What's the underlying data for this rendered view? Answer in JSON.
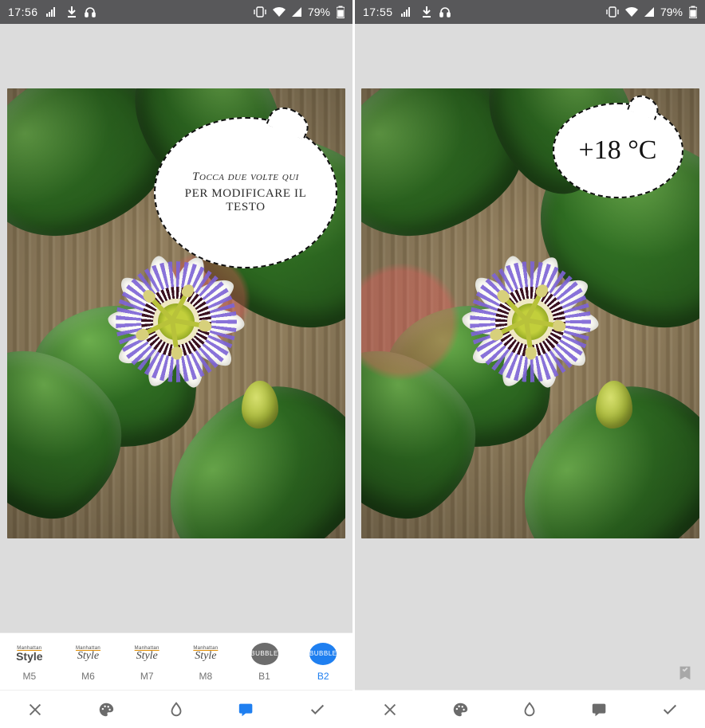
{
  "left": {
    "statusbar": {
      "time": "17:56",
      "battery": "79%"
    },
    "bubble": {
      "line1": "Tocca due volte qui",
      "line2": "PER MODIFICARE IL TESTO"
    },
    "styles": [
      {
        "key": "m5",
        "label": "M5",
        "kind": "style",
        "mode": "bold"
      },
      {
        "key": "m6",
        "label": "M6",
        "kind": "style",
        "mode": "italic"
      },
      {
        "key": "m7",
        "label": "M7",
        "kind": "style",
        "mode": "italic"
      },
      {
        "key": "m8",
        "label": "M8",
        "kind": "style",
        "mode": "italic"
      },
      {
        "key": "b1",
        "label": "B1",
        "kind": "bubble",
        "color": "grey",
        "bubble_label": "BUBBLE"
      },
      {
        "key": "b2",
        "label": "B2",
        "kind": "bubble",
        "color": "blue",
        "bubble_label": "BUBBLE",
        "active": true
      }
    ],
    "toolbar": {
      "close": "close-icon",
      "palette": "palette-icon",
      "drop": "drop-icon",
      "text_bubble": "text-bubble-icon",
      "confirm": "check-icon",
      "active": "text_bubble"
    }
  },
  "right": {
    "statusbar": {
      "time": "17:55",
      "battery": "79%"
    },
    "bubble": {
      "text": "+18 °C"
    },
    "toolbar": {
      "close": "close-icon",
      "palette": "palette-icon",
      "drop": "drop-icon",
      "text_bubble": "text-bubble-icon",
      "confirm": "check-icon",
      "active": null
    }
  },
  "thumb_text": {
    "overline": "Manhattan",
    "word": "Style"
  }
}
